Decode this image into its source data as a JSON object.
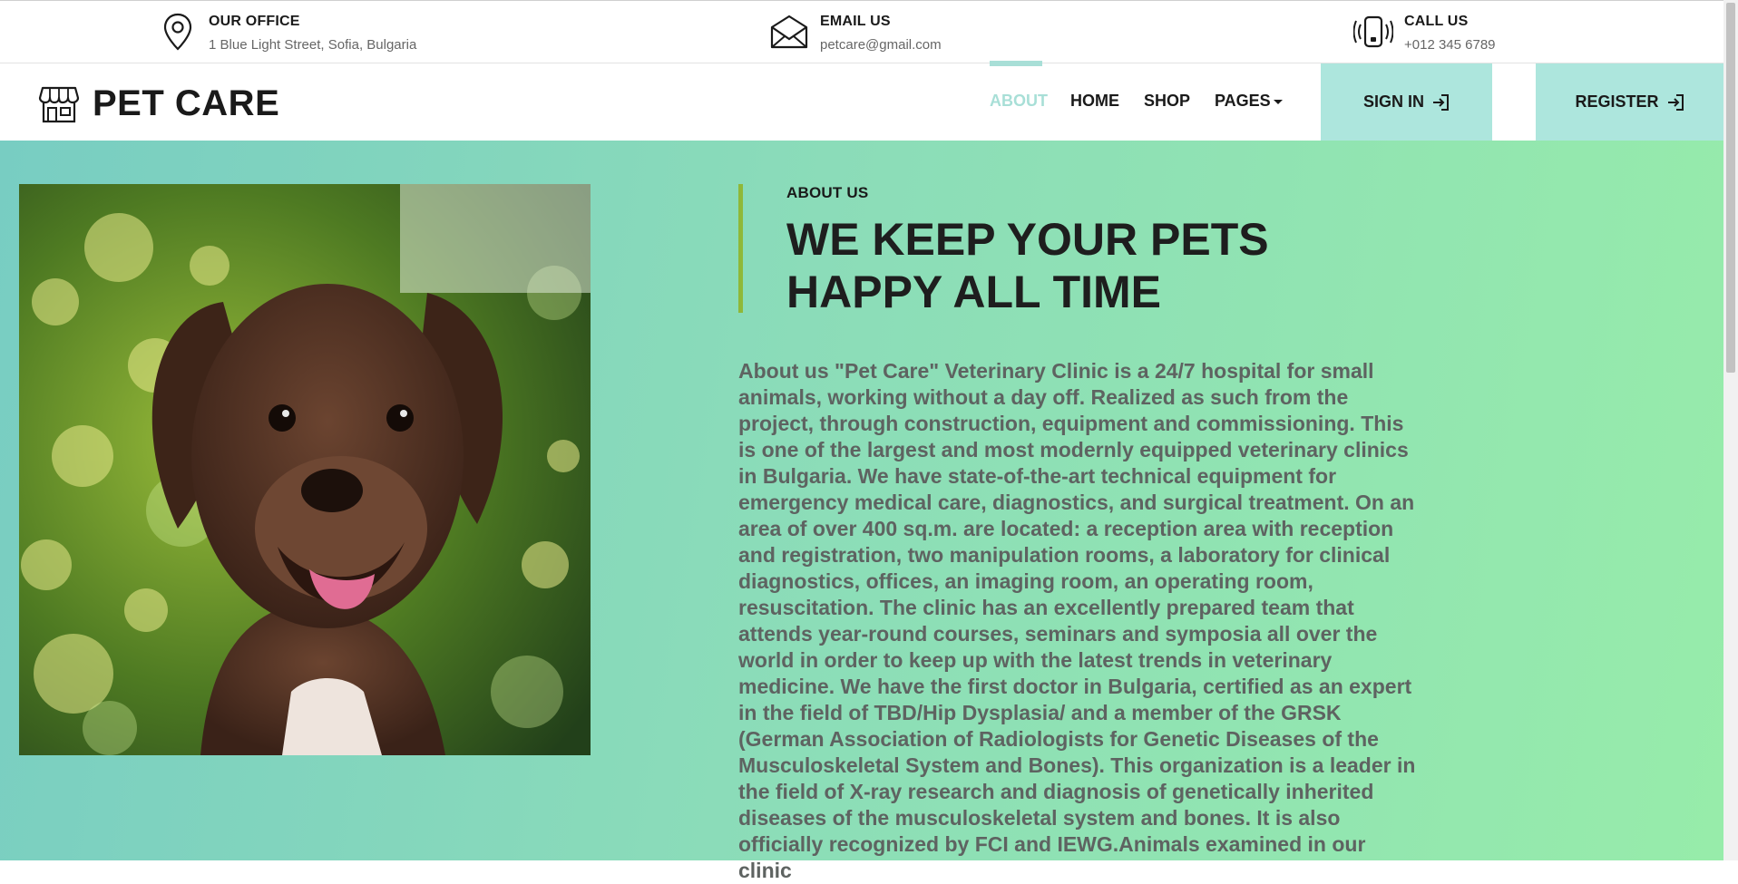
{
  "topbar": {
    "office": {
      "title": "OUR OFFICE",
      "value": "1 Blue Light Street, Sofia, Bulgaria",
      "icon": "location-pin-icon"
    },
    "email": {
      "title": "EMAIL US",
      "value": "petcare@gmail.com",
      "icon": "envelope-icon"
    },
    "call": {
      "title": "CALL US",
      "value": "+012 345 6789",
      "icon": "vibrating-phone-icon"
    }
  },
  "navbar": {
    "brand": "PET CARE",
    "brand_icon": "storefront-icon",
    "links": {
      "about": "ABOUT",
      "home": "HOME",
      "shop": "SHOP",
      "pages": "PAGES"
    },
    "active_link": "ABOUT",
    "sign_in": "SIGN IN",
    "register": "REGISTER",
    "button_icon": "sign-in-arrow-icon",
    "accent_color": "#ade6dd"
  },
  "about": {
    "label": "ABOUT US",
    "title": "WE KEEP YOUR PETS HAPPY ALL TIME",
    "body": "About us \"Pet Care\" Veterinary Clinic is a 24/7 hospital for small animals, working without a day off. Realized as such from the project, through construction, equipment and commissioning. This is one of the largest and most modernly equipped veterinary clinics in Bulgaria. We have state-of-the-art technical equipment for emergency medical care, diagnostics, and surgical treatment. On an area of over 400 sq.m. are located: a reception area with reception and registration, two manipulation rooms, a laboratory for clinical diagnostics, offices, an imaging room, an operating room, resuscitation. The clinic has an excellently prepared team that attends year-round courses, seminars and symposia all over the world in order to keep up with the latest trends in veterinary medicine. We have the first doctor in Bulgaria, certified as an expert in the field of TBD/Hip Dysplasia/ and a member of the GRSK (German Association of Radiologists for Genetic Diseases of the Musculoskeletal System and Bones). This organization is a leader in the field of X-ray research and diagnosis of genetically inherited diseases of the musculoskeletal system and bones. It is also officially recognized by FCI and IEWG.Animals examined in our clinic",
    "image": "puppy-photo",
    "border_color": "#8fb839"
  }
}
